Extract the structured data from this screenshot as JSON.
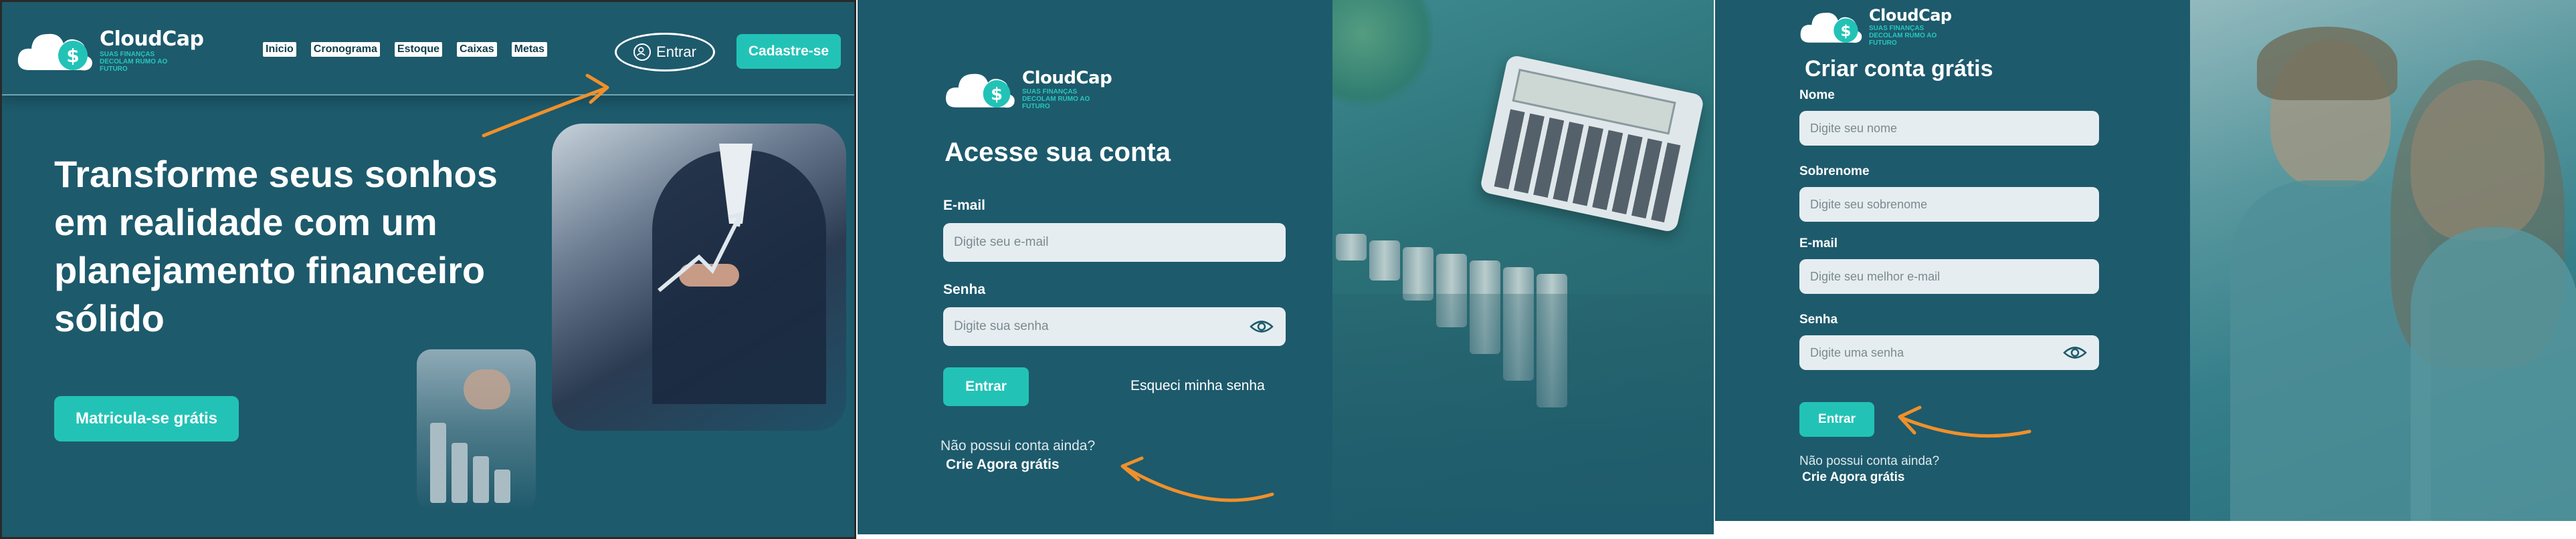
{
  "brand": {
    "name": "CloudCap",
    "tagline": "Suas finanças decolam rumo ao futuro",
    "colors": {
      "primary": "#1d5a6c",
      "accent": "#22c3b6",
      "annotation": "#f0902a"
    }
  },
  "landing": {
    "nav": [
      "Inicio",
      "Cronograma",
      "Estoque",
      "Caixas",
      "Metas"
    ],
    "login_label": "Entrar",
    "signup_label": "Cadastre-se",
    "hero_title": "Transforme seus sonhos em realidade com um planejamento financeiro sólido",
    "cta_label": "Matricula-se grátis"
  },
  "login": {
    "title": "Acesse sua conta",
    "email_label": "E-mail",
    "email_placeholder": "Digite seu e-mail",
    "password_label": "Senha",
    "password_placeholder": "Digite sua senha",
    "submit_label": "Entrar",
    "forgot_label": "Esqueci minha senha",
    "no_account_text": "Não possui conta ainda?",
    "create_link": "Crie Agora grátis"
  },
  "signup": {
    "title": "Criar conta grátis",
    "name_label": "Nome",
    "name_placeholder": "Digite seu nome",
    "surname_label": "Sobrenome",
    "surname_placeholder": "Digite seu sobrenome",
    "email_label": "E-mail",
    "email_placeholder": "Digite seu melhor e-mail",
    "password_label": "Senha",
    "password_placeholder": "Digite uma senha",
    "submit_label": "Entrar",
    "no_account_text": "Não possui conta ainda?",
    "create_link": "Crie Agora grátis"
  }
}
